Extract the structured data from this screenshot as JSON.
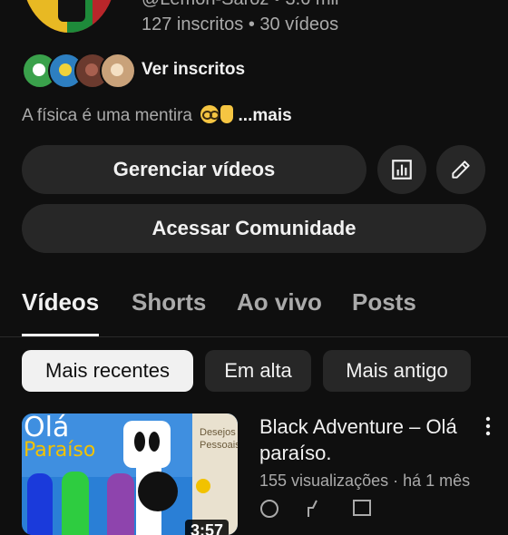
{
  "channel": {
    "handle_line": "@Lemon-Saroz • 3.6 mil",
    "subscribers": "127 inscritos",
    "videos_count": "30 vídeos",
    "stats_separator": " • ",
    "see_subscribers": "Ver inscritos",
    "description": "A física é uma mentira",
    "more": "...mais"
  },
  "actions": {
    "manage_videos": "Gerenciar vídeos",
    "community": "Acessar Comunidade",
    "analytics_icon": "analytics-icon",
    "edit_icon": "edit-pencil-icon"
  },
  "tabs": [
    {
      "label": "Vídeos",
      "active": true
    },
    {
      "label": "Shorts",
      "active": false
    },
    {
      "label": "Ao vivo",
      "active": false
    },
    {
      "label": "Posts",
      "active": false
    }
  ],
  "chips": [
    {
      "label": "Mais recentes",
      "selected": true
    },
    {
      "label": "Em alta",
      "selected": false
    },
    {
      "label": "Mais antigo",
      "selected": false
    }
  ],
  "video": {
    "title": "Black Adventure – Olá paraíso.",
    "views": "155 visualizações",
    "age": "há 1 mês",
    "meta_separator": " · ",
    "duration": "3:57",
    "thumb_text1": "Olá",
    "thumb_text2": "Paraíso",
    "thumb_panel_text": "Desejos Pessoais"
  },
  "colors": {
    "background": "#0f0f0f",
    "button": "#272727",
    "text_primary": "#f1f1f1",
    "text_secondary": "#aaaaaa"
  }
}
